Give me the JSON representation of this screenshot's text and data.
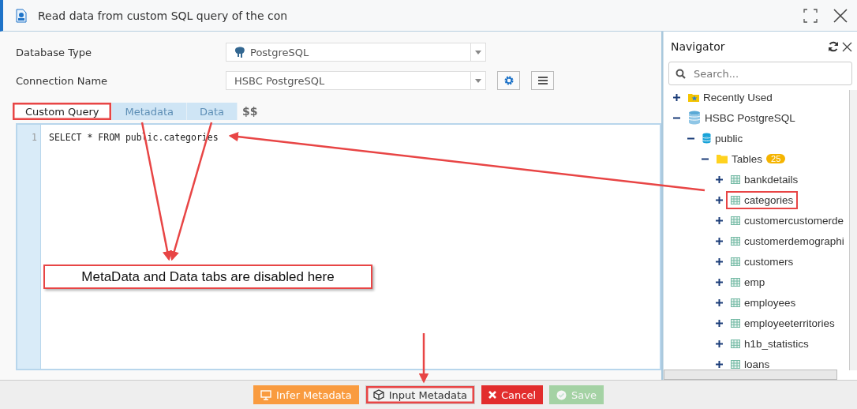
{
  "window": {
    "title": "Read data from custom SQL query of the con"
  },
  "form": [
    {
      "label": "Database Type",
      "value": "PostgreSQL",
      "kind": "db"
    },
    {
      "label": "Connection Name",
      "value": "HSBC PostgreSQL",
      "kind": "conn"
    }
  ],
  "tabs": [
    {
      "label": "Custom Query",
      "selected": true,
      "disabled": false,
      "annotated": true
    },
    {
      "label": "Metadata",
      "selected": false,
      "disabled": true,
      "annotated": false
    },
    {
      "label": "Data",
      "selected": false,
      "disabled": true,
      "annotated": false
    }
  ],
  "tabs_suffix": "$$",
  "editor": {
    "lines": [
      {
        "number": "1",
        "code": "SELECT * FROM public.categories"
      }
    ]
  },
  "callout": "MetaData and Data tabs are disabled here",
  "navigator": {
    "title": "Navigator",
    "search": {
      "placeholder": "Search..."
    },
    "tree": [
      {
        "label": "Recently Used",
        "kind": "recent",
        "expanded": false,
        "annotated": false
      },
      {
        "label": "HSBC PostgreSQL",
        "kind": "database",
        "expanded": true,
        "annotated": false,
        "children": [
          {
            "label": "public",
            "kind": "schema",
            "expanded": true,
            "annotated": false,
            "children": [
              {
                "label": "Tables",
                "kind": "folder",
                "expanded": true,
                "annotated": false,
                "badge": "25",
                "children": [
                  {
                    "label": "bankdetails",
                    "kind": "table",
                    "expanded": false,
                    "annotated": false
                  },
                  {
                    "label": "categories",
                    "kind": "table",
                    "expanded": false,
                    "annotated": true
                  },
                  {
                    "label": "customercustomerde",
                    "kind": "table",
                    "expanded": false,
                    "annotated": false
                  },
                  {
                    "label": "customerdemographi",
                    "kind": "table",
                    "expanded": false,
                    "annotated": false
                  },
                  {
                    "label": "customers",
                    "kind": "table",
                    "expanded": false,
                    "annotated": false
                  },
                  {
                    "label": "emp",
                    "kind": "table",
                    "expanded": false,
                    "annotated": false
                  },
                  {
                    "label": "employees",
                    "kind": "table",
                    "expanded": false,
                    "annotated": false
                  },
                  {
                    "label": "employeeterritories",
                    "kind": "table",
                    "expanded": false,
                    "annotated": false
                  },
                  {
                    "label": "h1b_statistics",
                    "kind": "table",
                    "expanded": false,
                    "annotated": false
                  },
                  {
                    "label": "loans",
                    "kind": "table",
                    "expanded": false,
                    "annotated": false
                  }
                ]
              }
            ]
          }
        ]
      }
    ]
  },
  "buttons": [
    {
      "label": "Infer Metadata",
      "kind": "infer",
      "disabled": false,
      "annotated": false
    },
    {
      "label": "Input Metadata",
      "kind": "input",
      "disabled": false,
      "annotated": true
    },
    {
      "label": "Cancel",
      "kind": "cancel",
      "disabled": false,
      "annotated": false
    },
    {
      "label": "Save",
      "kind": "save",
      "disabled": true,
      "annotated": false
    }
  ]
}
